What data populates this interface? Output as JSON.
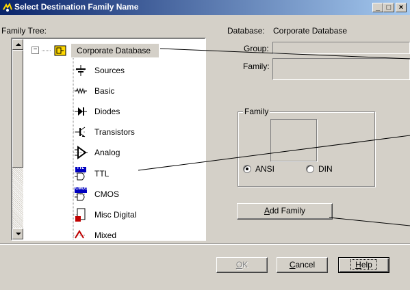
{
  "window": {
    "title": "Select Destination Family Name",
    "minimize_glyph": "_",
    "maximize_glyph": "□",
    "close_glyph": "×"
  },
  "tree_label": "Family Tree:",
  "tree": {
    "root": {
      "label": "Corporate Database",
      "expander": "−"
    },
    "items": [
      {
        "label": "Sources",
        "icon": "sources-icon"
      },
      {
        "label": "Basic",
        "icon": "resistor-icon"
      },
      {
        "label": "Diodes",
        "icon": "diode-icon"
      },
      {
        "label": "Transistors",
        "icon": "transistor-icon"
      },
      {
        "label": "Analog",
        "icon": "opamp-icon"
      },
      {
        "label": "TTL",
        "icon": "ttl-icon",
        "badge": "TTL"
      },
      {
        "label": "CMOS",
        "icon": "cmos-icon",
        "badge": "CMOS"
      },
      {
        "label": "Misc Digital",
        "icon": "misc-digital-icon"
      },
      {
        "label": "Mixed",
        "icon": "mixed-icon"
      }
    ]
  },
  "fields": {
    "database_label": "Database:",
    "database_value": "Corporate Database",
    "group_label": "Group:",
    "group_value": "",
    "family_label": "Family:",
    "family_value": ""
  },
  "family_group": {
    "legend": "Family",
    "ansi_label": "ANSI",
    "din_label": "DIN",
    "selected": "ANSI"
  },
  "buttons": {
    "add_family": {
      "mnemonic": "A",
      "rest": "dd Family"
    },
    "ok": {
      "mnemonic": "O",
      "rest": "K",
      "disabled": true
    },
    "cancel": {
      "mnemonic": "C",
      "rest": "ancel"
    },
    "help": {
      "mnemonic": "H",
      "rest": "elp"
    }
  },
  "colors": {
    "titlebar_start": "#0a246a",
    "titlebar_end": "#a6caf0",
    "dialog_face": "#d4d0c8",
    "selection_bg": "#d4d0c8"
  }
}
